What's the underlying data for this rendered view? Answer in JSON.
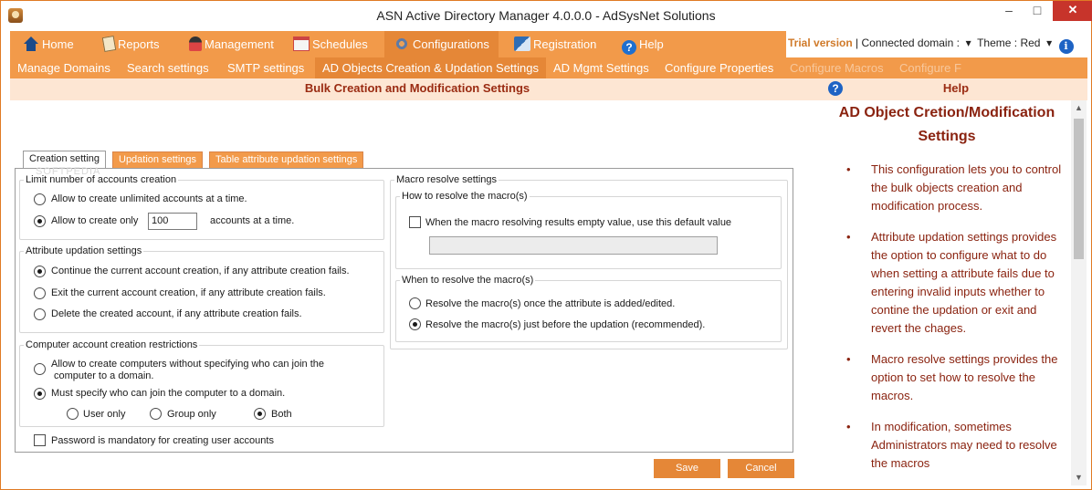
{
  "window": {
    "title": "ASN Active Directory Manager 4.0.0.0 - AdSysNet Solutions",
    "minimize": "–",
    "maximize": "□",
    "close": "✕"
  },
  "main_nav": {
    "items": [
      {
        "label": "Home",
        "icon": "home-icon"
      },
      {
        "label": "Reports",
        "icon": "reports-icon"
      },
      {
        "label": "Management",
        "icon": "management-icon"
      },
      {
        "label": "Schedules",
        "icon": "schedules-icon"
      },
      {
        "label": "Configurations",
        "icon": "configurations-icon",
        "active": true
      },
      {
        "label": "Registration",
        "icon": "registration-icon"
      },
      {
        "label": "Help",
        "icon": "help-icon"
      }
    ],
    "trial": "Trial version",
    "separator": "|",
    "connected": "Connected domain :",
    "theme": "Theme : Red"
  },
  "sub_nav": {
    "items": [
      "Manage Domains",
      "Search settings",
      "SMTP settings",
      "AD Objects Creation & Updation Settings",
      "AD Mgmt Settings",
      "Configure Properties",
      "Configure Macros",
      "Configure F"
    ],
    "active_index": 3
  },
  "section_header": "Bulk Creation and Modification Settings",
  "help": {
    "header": "Help",
    "title": "AD Object Cretion/Modification Settings",
    "items": [
      "This configuration lets you to control the bulk objects creation and modification process.",
      "Attribute updation settings provides the option to configure what to do when setting a attribute fails due to entering invalid inputs whether to contine the updation or exit and revert the chages.",
      "Macro resolve settings provides the option to set how to resolve the macros.",
      "In modification, sometimes Administrators may need to resolve the macros"
    ]
  },
  "tabs": [
    "Creation setting",
    "Updation settings",
    "Table attribute updation settings"
  ],
  "watermark": "SOFTPEDIA",
  "limit_group": {
    "legend": "Limit number of accounts creation",
    "opt_unlimited": "Allow to create unlimited accounts at a time.",
    "opt_limit": "Allow to create only",
    "limit_value": "100",
    "limit_suffix": "accounts at a time.",
    "selected": "limit"
  },
  "attr_group": {
    "legend": "Attribute updation settings",
    "options": [
      "Continue the current account creation, if any attribute creation fails.",
      "Exit the current account creation, if any attribute creation fails.",
      "Delete the created account, if any attribute creation fails."
    ],
    "selected": 0
  },
  "computer_group": {
    "legend": "Computer account creation restrictions",
    "opt_allow_line1": "Allow to create computers without specifying who can join the",
    "opt_allow_line2": "computer to a domain.",
    "opt_must": "Must specify who can join the computer to a domain.",
    "sub_options": [
      "User only",
      "Group only",
      "Both"
    ],
    "selected": "must",
    "sub_selected": 2
  },
  "password_check": {
    "label": "Password is mandatory for creating user accounts",
    "checked": false
  },
  "macro_group": {
    "legend": "Macro resolve settings",
    "how": {
      "legend": "How to resolve the macro(s)",
      "check_label": "When the macro resolving results empty value, use this default value",
      "checked": false,
      "default_value": ""
    },
    "when": {
      "legend": "When to resolve the macro(s)",
      "options": [
        "Resolve the macro(s) once the attribute is added/edited.",
        "Resolve the macro(s) just before the updation (recommended)."
      ],
      "selected": 1
    }
  },
  "buttons": {
    "save": "Save",
    "cancel": "Cancel"
  },
  "colors": {
    "accent": "#f29a4a",
    "accent_dark": "#e58737",
    "header_bg": "#fde6d3",
    "header_text": "#9a2b12",
    "close": "#c7342b"
  }
}
